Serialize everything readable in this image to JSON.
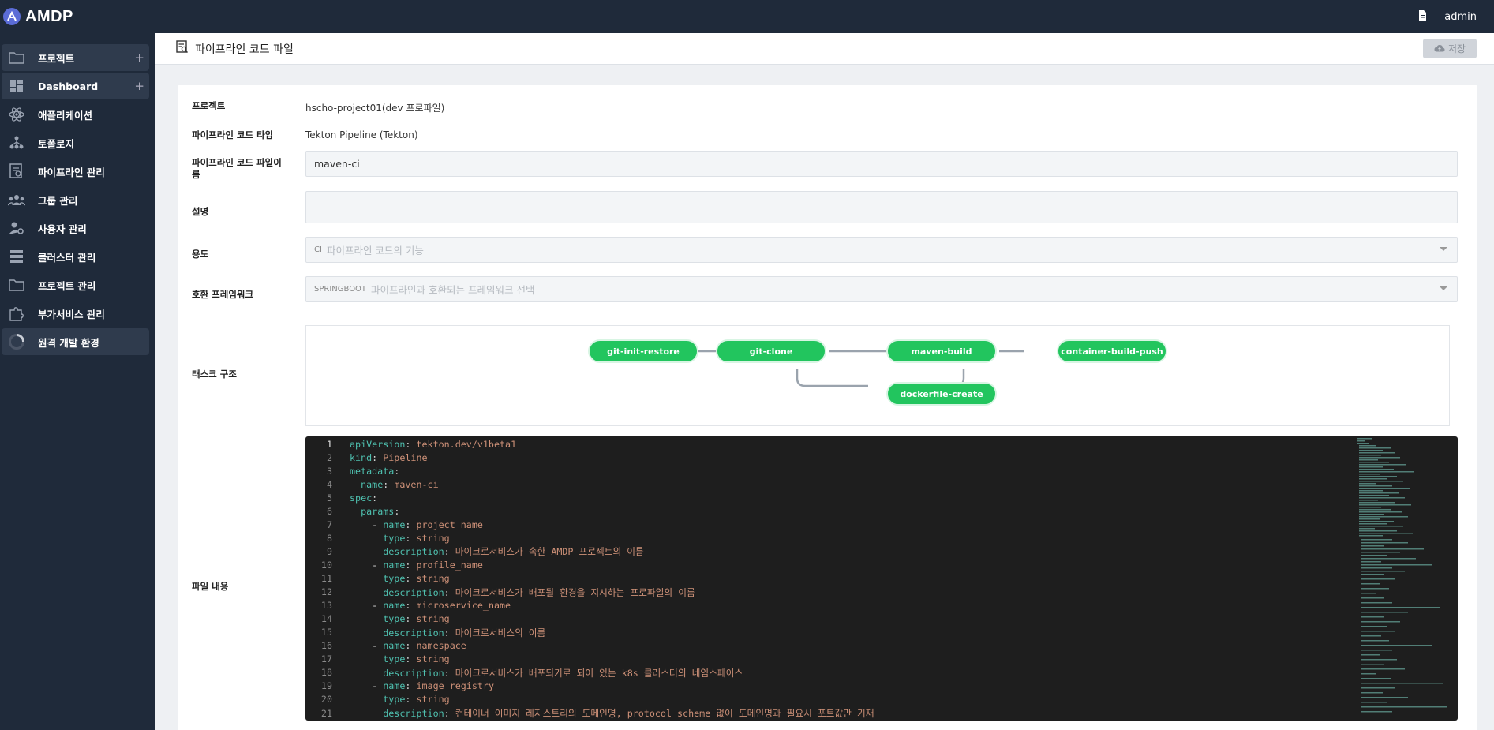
{
  "app": {
    "name": "AMDP"
  },
  "topbar": {
    "user": "admin",
    "doc_icon": "document-icon"
  },
  "sidebar": {
    "items": [
      {
        "label": "프로젝트",
        "icon": "folder-icon",
        "plus": "+"
      },
      {
        "label": "Dashboard",
        "icon": "dashboard-icon",
        "plus": "+"
      },
      {
        "label": "애플리케이션",
        "icon": "atom-icon"
      },
      {
        "label": "토폴로지",
        "icon": "topology-icon"
      },
      {
        "label": "파이프라인 관리",
        "icon": "pipeline-icon"
      },
      {
        "label": "그룹 관리",
        "icon": "group-icon"
      },
      {
        "label": "사용자 관리",
        "icon": "user-gear-icon"
      },
      {
        "label": "클러스터 관리",
        "icon": "server-icon"
      },
      {
        "label": "프로젝트 관리",
        "icon": "folder-icon"
      },
      {
        "label": "부가서비스 관리",
        "icon": "puzzle-icon"
      },
      {
        "label": "원격 개발 환경",
        "icon": "spinner-icon"
      }
    ]
  },
  "header": {
    "title": "파이프라인 코드 파일",
    "save_label": "저장"
  },
  "form": {
    "project_label": "프로젝트",
    "project_value": "hscho-project01(dev 프로파일)",
    "type_label": "파이프라인 코드 타입",
    "type_value": "Tekton Pipeline (Tekton)",
    "name_label": "파이프라인 코드 파일이름",
    "name_value": "maven-ci",
    "desc_label": "설명",
    "desc_value": "",
    "usage_label": "용도",
    "usage_tag": "CI",
    "usage_placeholder": "파이프라인 코드의 기능",
    "framework_label": "호환 프레임워크",
    "framework_tag": "SPRINGBOOT",
    "framework_placeholder": "파이프라인과 호환되는 프레임워크 선택",
    "task_label": "태스크 구조",
    "content_label": "파일 내용"
  },
  "tasks": [
    "git-init-restore",
    "git-clone",
    "maven-build",
    "container-build-push",
    "dockerfile-create"
  ],
  "colors": {
    "node": "#22c55e",
    "sidebar": "#1f2a3a",
    "editor_bg": "#1e1e1e",
    "yaml_key": "#4fc1b0",
    "yaml_value": "#ce9178"
  },
  "code": [
    {
      "n": "1",
      "i": "",
      "k": "apiVersion",
      "v": "tekton.dev/v1beta1"
    },
    {
      "n": "2",
      "i": "",
      "k": "kind",
      "v": "Pipeline"
    },
    {
      "n": "3",
      "i": "",
      "k": "metadata",
      "v": ""
    },
    {
      "n": "4",
      "i": "  ",
      "k": "name",
      "v": "maven-ci"
    },
    {
      "n": "5",
      "i": "",
      "k": "spec",
      "v": ""
    },
    {
      "n": "6",
      "i": "  ",
      "k": "params",
      "v": ""
    },
    {
      "n": "7",
      "i": "    - ",
      "k": "name",
      "v": "project_name"
    },
    {
      "n": "8",
      "i": "      ",
      "k": "type",
      "v": "string"
    },
    {
      "n": "9",
      "i": "      ",
      "k": "description",
      "v": "마이크로서비스가 속한 AMDP 프로젝트의 이름"
    },
    {
      "n": "10",
      "i": "    - ",
      "k": "name",
      "v": "profile_name"
    },
    {
      "n": "11",
      "i": "      ",
      "k": "type",
      "v": "string"
    },
    {
      "n": "12",
      "i": "      ",
      "k": "description",
      "v": "마이크로서비스가 배포될 환경을 지시하는 프로파일의 이름"
    },
    {
      "n": "13",
      "i": "    - ",
      "k": "name",
      "v": "microservice_name"
    },
    {
      "n": "14",
      "i": "      ",
      "k": "type",
      "v": "string"
    },
    {
      "n": "15",
      "i": "      ",
      "k": "description",
      "v": "마이크로서비스의 이름"
    },
    {
      "n": "16",
      "i": "    - ",
      "k": "name",
      "v": "namespace"
    },
    {
      "n": "17",
      "i": "      ",
      "k": "type",
      "v": "string"
    },
    {
      "n": "18",
      "i": "      ",
      "k": "description",
      "v": "마이크로서비스가 배포되기로 되어 있는 k8s 클러스터의 네임스페이스"
    },
    {
      "n": "19",
      "i": "    - ",
      "k": "name",
      "v": "image_registry"
    },
    {
      "n": "20",
      "i": "      ",
      "k": "type",
      "v": "string"
    },
    {
      "n": "21",
      "i": "      ",
      "k": "description",
      "v": "컨테이너 이미지 레지스트리의 도메인명, protocol scheme 없이 도메인명과 필요시 포트값만 기재"
    }
  ]
}
